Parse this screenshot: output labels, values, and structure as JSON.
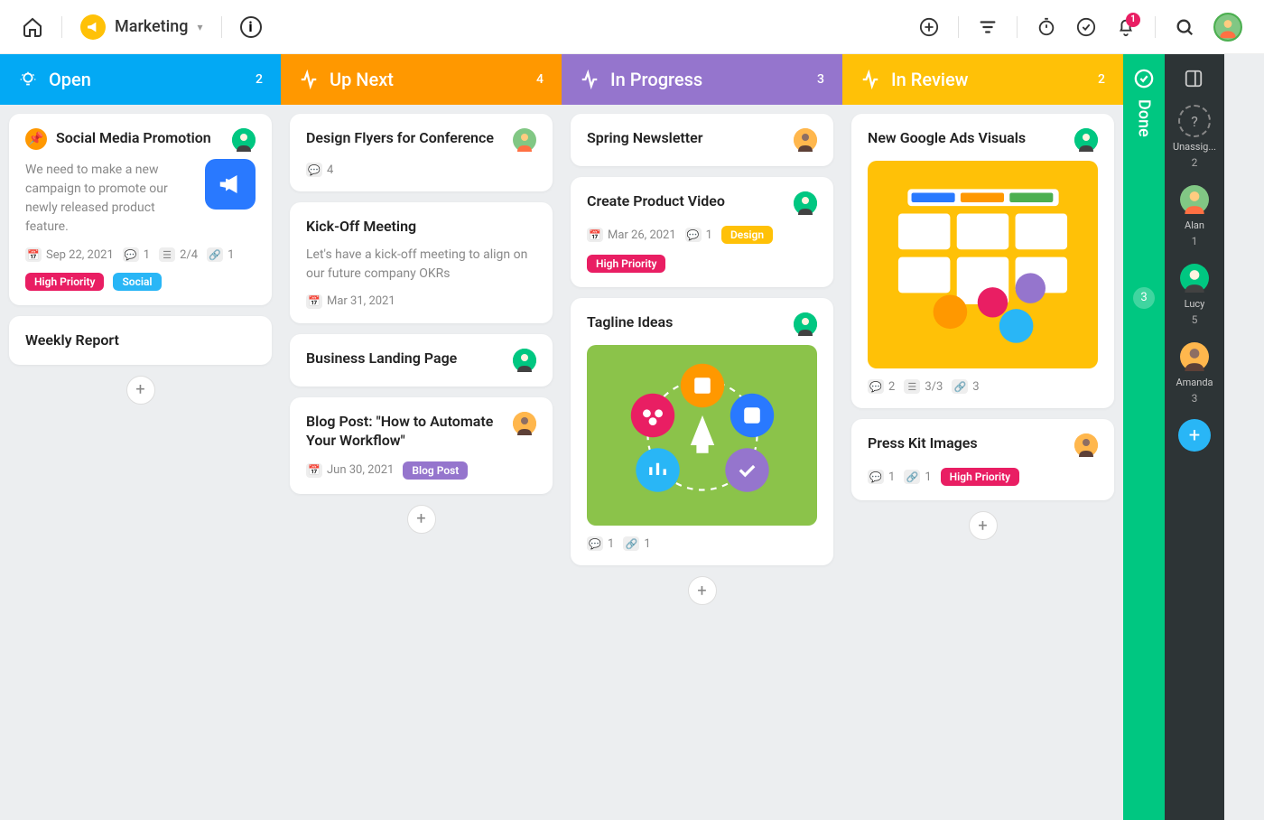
{
  "workspace": {
    "name": "Marketing"
  },
  "notifications": {
    "count": "1"
  },
  "columns": {
    "open": {
      "title": "Open",
      "count": "2",
      "color": "#03a9f4"
    },
    "upnext": {
      "title": "Up Next",
      "count": "4",
      "color": "#ff9800"
    },
    "progress": {
      "title": "In Progress",
      "count": "3",
      "color": "#9575cd"
    },
    "review": {
      "title": "In Review",
      "count": "2",
      "color": "#ffc107"
    },
    "done": {
      "title": "Done",
      "count": "3"
    }
  },
  "cards": {
    "social": {
      "title": "Social Media Promotion",
      "desc": "We need to make a new campaign to promote our newly released product feature.",
      "date": "Sep 22, 2021",
      "comments": "1",
      "checklist": "2/4",
      "attachments": "1",
      "tags": [
        "High Priority",
        "Social"
      ]
    },
    "weekly": {
      "title": "Weekly Report"
    },
    "flyers": {
      "title": "Design Flyers for Conference",
      "comments": "4"
    },
    "kickoff": {
      "title": "Kick-Off Meeting",
      "desc": "Let's have a kick-off meeting to align on our future company OKRs",
      "date": "Mar 31, 2021"
    },
    "landing": {
      "title": "Business Landing Page"
    },
    "blog": {
      "title": "Blog Post: \"How to Automate Your Workflow\"",
      "date": "Jun 30, 2021",
      "tag": "Blog Post"
    },
    "newsletter": {
      "title": "Spring Newsletter"
    },
    "video": {
      "title": "Create Product Video",
      "date": "Mar 26, 2021",
      "comments": "1",
      "tag": "Design",
      "priority": "High Priority"
    },
    "tagline": {
      "title": "Tagline Ideas",
      "comments": "1",
      "attachments": "1"
    },
    "ads": {
      "title": "New Google Ads Visuals",
      "comments": "2",
      "checklist": "3/3",
      "attachments": "3"
    },
    "presskit": {
      "title": "Press Kit Images",
      "comments": "1",
      "attachments": "1",
      "priority": "High Priority"
    }
  },
  "sidebar": [
    {
      "name": "Unassig...",
      "count": "2",
      "color": "#555"
    },
    {
      "name": "Alan",
      "count": "1",
      "color": "#4caf50"
    },
    {
      "name": "Lucy",
      "count": "5",
      "color": "#00c781"
    },
    {
      "name": "Amanda",
      "count": "3",
      "color": "#ffb74d"
    }
  ]
}
